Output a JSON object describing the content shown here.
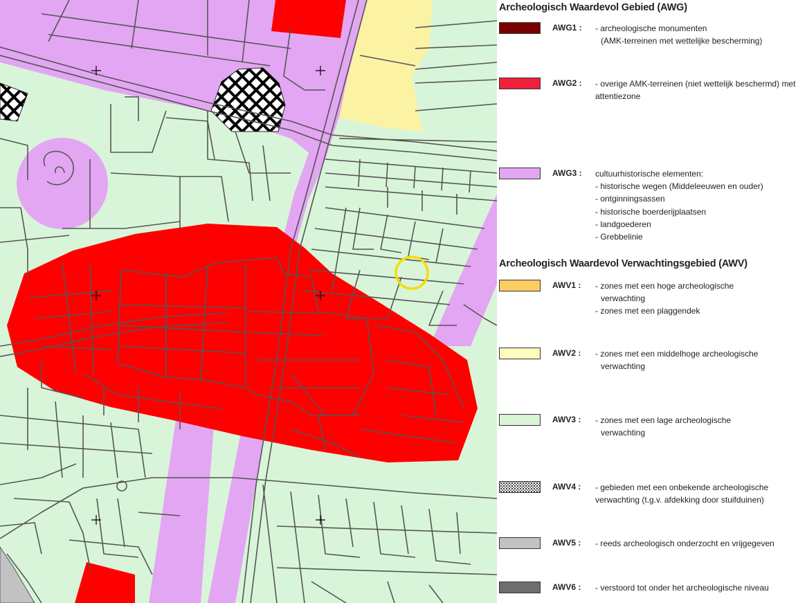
{
  "map": {
    "colors": {
      "awv3_background": "#d9f5d9",
      "awg3_purple": "#e3a6f3",
      "awg2_red": "#ff0000",
      "awv2_yellow": "#fcf2a4",
      "road_line": "#555555",
      "marker_circle": "#f5dd00"
    },
    "icons": [
      "crosshair-icon",
      "hatched-area",
      "yellow-circle-marker"
    ]
  },
  "legend": {
    "awg_heading": "Archeologisch Waardevol Gebied (AWG)",
    "awv_heading": "Archeologisch Waardevol Verwachtingsgebied (AWV)",
    "entries": [
      {
        "code": "AWG1 :",
        "color": "#7a0000",
        "lines": [
          "- archeologische monumenten",
          "(AMK-terreinen met wettelijke bescherming)"
        ]
      },
      {
        "code": "AWG2 :",
        "color": "#f0203a",
        "lines": [
          "- overige AMK-terreinen (niet wettelijk beschermd) met",
          "attentiezone"
        ]
      },
      {
        "code": "AWG3 :",
        "color": "#e3a6f3",
        "lines": [
          "cultuurhistorische elementen:",
          "- historische wegen (Middeleeuwen en ouder)",
          "- ontginningsassen",
          "- historische boerderijplaatsen",
          "- landgoederen",
          "- Grebbelinie"
        ]
      },
      {
        "code": "AWV1 :",
        "color": "#fbcd62",
        "lines": [
          "- zones met een hoge archeologische",
          "verwachting",
          "- zones met een plaggendek"
        ]
      },
      {
        "code": "AWV2 :",
        "color": "#fdfbbd",
        "lines": [
          "- zones met een middelhoge archeologische",
          "verwachting"
        ]
      },
      {
        "code": "AWV3 :",
        "color": "#daf5d6",
        "lines": [
          "- zones met een lage archeologische",
          "verwachting"
        ]
      },
      {
        "code": "AWV4 :",
        "color": "pattern",
        "lines": [
          "- gebieden met een onbekende archeologische",
          "verwachting (t.g.v. afdekking door stuifduinen)"
        ]
      },
      {
        "code": "AWV5 :",
        "color": "#c2c2c2",
        "lines": [
          "- reeds archeologisch onderzocht en vrijgegeven"
        ]
      },
      {
        "code": "AWV6 :",
        "color": "#6e6e6e",
        "lines": [
          "- verstoord tot onder het archeologische niveau"
        ]
      }
    ]
  }
}
